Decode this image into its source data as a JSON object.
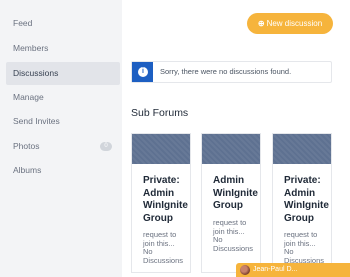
{
  "sidebar": {
    "items": [
      {
        "label": "Feed"
      },
      {
        "label": "Members"
      },
      {
        "label": "Discussions"
      },
      {
        "label": "Manage"
      },
      {
        "label": "Send Invites"
      },
      {
        "label": "Photos",
        "count": "0"
      },
      {
        "label": "Albums"
      }
    ],
    "active": "Discussions"
  },
  "toolbar": {
    "new_discussion_label": "New discussion"
  },
  "notice": {
    "message": "Sorry, there were no discussions found."
  },
  "subforums": {
    "title": "Sub Forums",
    "cards": [
      {
        "name": "Private: Admin WinIgnite Group",
        "description": "request to join this...",
        "discussions": "No Discussions"
      },
      {
        "name": "Admin WinIgnite Group",
        "description": "request to join this...",
        "discussions": "No Discussions"
      },
      {
        "name": "Private: Admin WinIgnite Group",
        "description": "request to join this...",
        "discussions": "No Discussions"
      }
    ]
  },
  "chat": {
    "name": "Jean-Paul D..."
  },
  "colors": {
    "accent": "#f6b43c",
    "info": "#1d5fc2",
    "card_cover": "#5e7191"
  }
}
